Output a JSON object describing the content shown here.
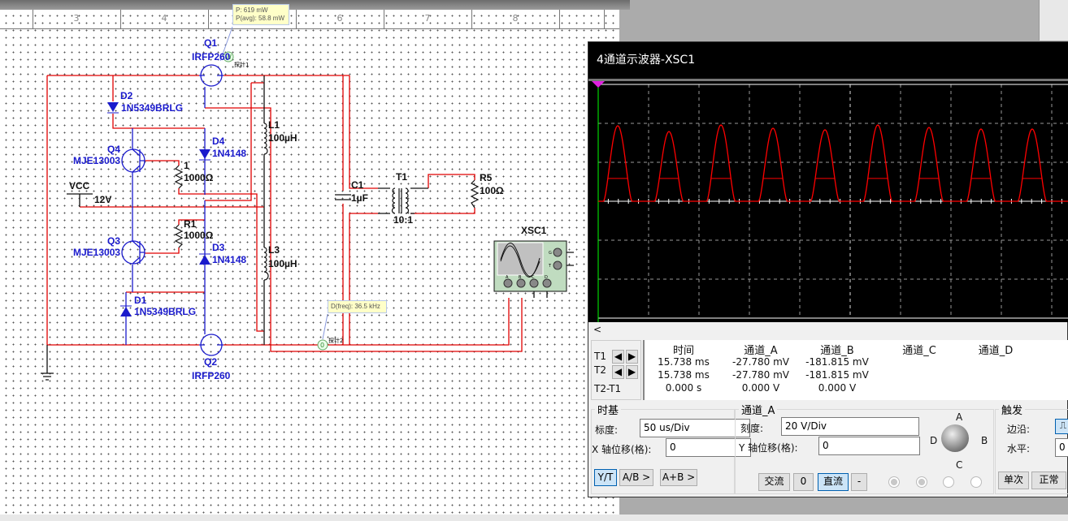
{
  "ruler": {
    "numbers": [
      "3",
      "4",
      "5",
      "6",
      "7",
      "8"
    ]
  },
  "schematic": {
    "components": {
      "Q1": {
        "ref": "Q1",
        "model": "IRFP260"
      },
      "Q2": {
        "ref": "Q2",
        "model": "IRFP260"
      },
      "Q3": {
        "ref": "Q3",
        "model": "MJE13003"
      },
      "Q4": {
        "ref": "Q4",
        "model": "MJE13003"
      },
      "D1": {
        "ref": "D1",
        "model": "1N5349BRLG"
      },
      "D2": {
        "ref": "D2",
        "model": "1N5349BRLG"
      },
      "D3": {
        "ref": "D3",
        "model": "1N4148"
      },
      "D4": {
        "ref": "D4",
        "model": "1N4148"
      },
      "R1": {
        "ref": "R1",
        "value": "1000Ω"
      },
      "R2": {
        "ref": "1",
        "value": "1000Ω"
      },
      "R5": {
        "ref": "R5",
        "value": "100Ω"
      },
      "L1": {
        "ref": "L1",
        "value": "100µH"
      },
      "L3": {
        "ref": "L3",
        "value": "100µH"
      },
      "C1": {
        "ref": "C1",
        "value": "1µF"
      },
      "T1": {
        "ref": "T1",
        "ratio": "10:1"
      },
      "VCC": {
        "ref": "VCC",
        "value": "12V"
      },
      "XSC1": {
        "ref": "XSC1",
        "terminals": [
          "A",
          "B",
          "C",
          "D"
        ],
        "side_terminals": [
          "G",
          "T"
        ]
      }
    },
    "probe1": {
      "symbol": "W",
      "label": "探针1",
      "tooltip_line1": "P: 619 mW",
      "tooltip_line2": "P(avg): 58.8 mW"
    },
    "probe2": {
      "symbol": "0",
      "label": "探针2",
      "tooltip": "D(freq): 36.5 kHz"
    },
    "wire_color": "#e00000",
    "component_color": "#1a1acc"
  },
  "scope": {
    "title": "4通道示波器-XSC1",
    "scroll_left": "<",
    "cursors": {
      "labels": [
        "T1",
        "T2",
        "T2-T1"
      ],
      "headers": [
        "时间",
        "通道_A",
        "通道_B",
        "通道_C",
        "通道_D"
      ],
      "rows": [
        [
          "15.738 ms",
          "-27.780 mV",
          "-181.815 mV",
          "",
          ""
        ],
        [
          "15.738 ms",
          "-27.780 mV",
          "-181.815 mV",
          "",
          ""
        ],
        [
          "0.000 s",
          "0.000 V",
          "0.000 V",
          "",
          ""
        ]
      ]
    },
    "timebase": {
      "title": "时基",
      "scale_label": "标度:",
      "scale_value": "50 us/Div",
      "xpos_label": "X 轴位移(格):",
      "xpos_value": "0",
      "modes": [
        "Y/T",
        "A/B >",
        "A+B >"
      ],
      "selected_mode": "Y/T"
    },
    "channel": {
      "title": "通道_A",
      "scale_label": "刻度:",
      "scale_value": "20  V/Div",
      "ypos_label": "Y 轴位移(格):",
      "ypos_value": "0",
      "coupling": [
        "交流",
        "0",
        "直流",
        "-"
      ],
      "selected_coupling": "直流",
      "knob_labels": [
        "A",
        "B",
        "C",
        "D"
      ],
      "selected_channel": "A"
    },
    "trigger": {
      "title": "触发",
      "edge_label": "边沿:",
      "level_label": "水平:",
      "level_value": "0",
      "buttons": [
        "单次",
        "正常"
      ]
    }
  },
  "chart_data": {
    "type": "line",
    "x_unit": "us",
    "y_unit": "V",
    "x_per_div": 50,
    "y_per_div": 20,
    "xlim": [
      0,
      467
    ],
    "ylim": [
      -60,
      60
    ],
    "grid": true,
    "trace_color": "#ff0000",
    "pulse_peak_times": [
      19.4,
      70.2,
      121.8,
      173.4,
      225.0,
      277.4,
      328.2,
      379.8,
      430.6
    ],
    "pulse_peak_values": [
      38.8,
      35.8,
      39.2,
      37.5,
      36.7,
      39.2,
      37.9,
      37.1,
      37.1
    ],
    "pulse_shoulder_value": 11.7,
    "baseline_value": 0
  }
}
